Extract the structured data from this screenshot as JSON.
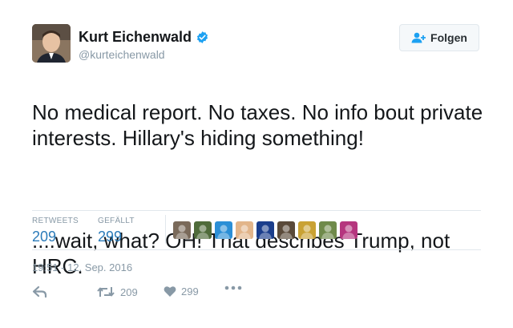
{
  "user": {
    "name": "Kurt Eichenwald",
    "handle": "@kurteichenwald",
    "verified_color": "#1da1f2"
  },
  "follow_button": {
    "label": "Folgen",
    "icon": "add-user-icon"
  },
  "tweet": {
    "text_line1": "No medical report. No taxes. No info bout private interests. Hillary's hiding something!",
    "text_line2": "....wait, what? OH! That describes Trump, not HRC."
  },
  "stats": {
    "retweets_label": "RETWEETS",
    "retweets_value": "209",
    "likes_label": "GEFÄLLT",
    "likes_value": "299"
  },
  "likers": [
    {
      "name": "liker-avatar-1",
      "color": "#7a6a5a"
    },
    {
      "name": "liker-avatar-2",
      "color": "#4f6b3a"
    },
    {
      "name": "liker-avatar-3",
      "color": "#2b8fd6"
    },
    {
      "name": "liker-avatar-4",
      "color": "#e2b58a"
    },
    {
      "name": "liker-avatar-5",
      "color": "#1b3e8c"
    },
    {
      "name": "liker-avatar-6",
      "color": "#5a4a3a"
    },
    {
      "name": "liker-avatar-7",
      "color": "#c9a234"
    },
    {
      "name": "liker-avatar-8",
      "color": "#6f8a4a"
    },
    {
      "name": "liker-avatar-9",
      "color": "#b5367e"
    }
  ],
  "timestamp": "19:51 - 12. Sep. 2016",
  "actions": {
    "reply_icon": "reply-icon",
    "retweet_icon": "retweet-icon",
    "retweet_count": "209",
    "like_icon": "heart-icon",
    "like_count": "299",
    "more_icon": "more-icon"
  },
  "colors": {
    "link_blue": "#2b7bb9",
    "muted": "#8899a6",
    "border": "#e1e8ed"
  }
}
